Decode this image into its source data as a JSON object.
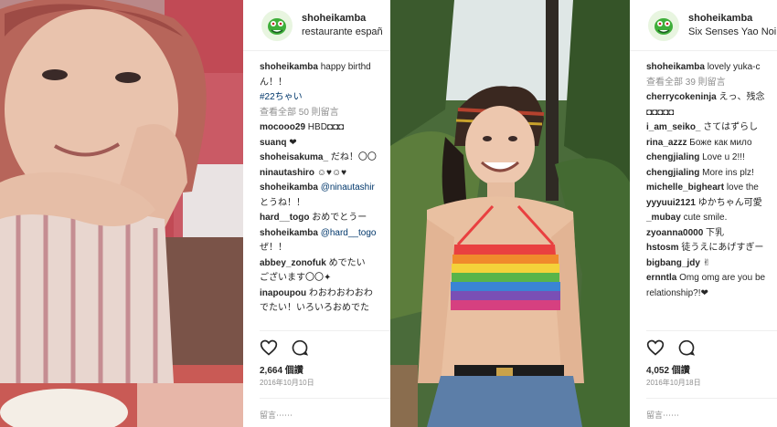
{
  "post1": {
    "username": "shoheikamba",
    "location": "restaurante españ",
    "caption_user": "shoheikamba",
    "caption_text": "happy birthd",
    "caption_line2": "ん！！",
    "caption_tag": "#22ちゃい",
    "view_all": "查看全部 50 則留言",
    "comments": [
      {
        "user": "mocooo29",
        "text": "HBD◘◘◘"
      },
      {
        "user": "suanq",
        "text": "❤"
      },
      {
        "user": "shoheisakuma_",
        "text": "だね！〇〇"
      },
      {
        "user": "ninautashiro",
        "text": "☺♥☺♥"
      },
      {
        "user": "shoheikamba",
        "text": "@ninautashir",
        "line2": "とうね！！"
      },
      {
        "user": "hard__togo",
        "text": "おめでとうー"
      },
      {
        "user": "shoheikamba",
        "text": "@hard__togo",
        "line2": "ぜ！！"
      },
      {
        "user": "abbey_zonofuk",
        "text": "めでたい",
        "line2": "ございます〇〇✦"
      },
      {
        "user": "inapoupou",
        "text": "わおわおわおわ",
        "line2": "でたい！いろいろおめでた"
      }
    ],
    "likes": "2,664 個讚",
    "date": "2016年10月10日",
    "add_comment": "留言⋯⋯",
    "icons": [
      "heart-icon",
      "comment-icon"
    ]
  },
  "post2": {
    "username": "shoheikamba",
    "location": "Six Senses Yao Noi",
    "caption_user": "shoheikamba",
    "caption_text": "lovely yuka-c",
    "view_all": "查看全部 39 則留言",
    "comments": [
      {
        "user": "cherrycokeninja",
        "text": "えっ、残念"
      },
      {
        "user": "",
        "text": "◘◘◘◘◘"
      },
      {
        "user": "i_am_seiko_",
        "text": "さてはずらし"
      },
      {
        "user": "rina_azzz",
        "text": "Боже как мило"
      },
      {
        "user": "chengjialing",
        "text": "Love u 2!!!"
      },
      {
        "user": "chengjialing",
        "text": "More ins plz!"
      },
      {
        "user": "michelle_bigheart",
        "text": "love the"
      },
      {
        "user": "yyyuui2121",
        "text": "ゆかちゃん可愛"
      },
      {
        "user": "_mubay",
        "text": "cute smile."
      },
      {
        "user": "zyoanna0000",
        "text": "下乳"
      },
      {
        "user": "hstosm",
        "text": "徒うえにあげすぎー"
      },
      {
        "user": "bigbang_jdy",
        "text": "✌"
      },
      {
        "user": "ernntla",
        "text": "Omg omg are you be",
        "line2": "relationship?!❤"
      }
    ],
    "likes": "4,052 個讚",
    "date": "2016年10月18日",
    "add_comment": "留言⋯⋯",
    "icons": [
      "heart-icon",
      "comment-icon"
    ]
  },
  "colors": {
    "text": "#262626",
    "muted": "#8e8e8e",
    "mention": "#00376b",
    "divider": "#efefef"
  }
}
